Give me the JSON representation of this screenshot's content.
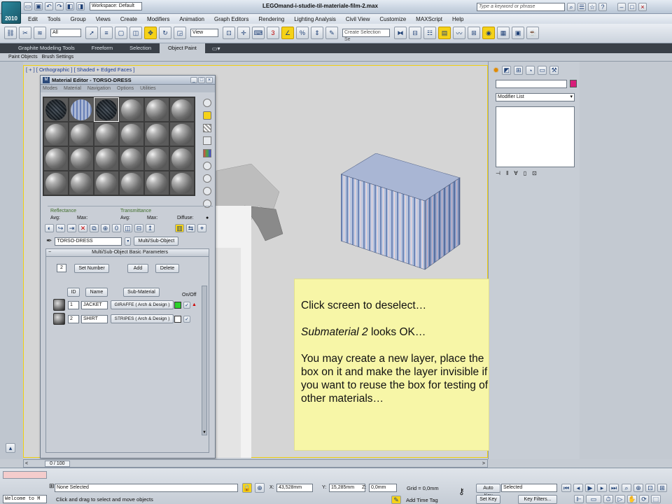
{
  "app": {
    "title": "LEGOmand-i-studie-til-materiale-film-2.max",
    "workspace": "Workspace: Default",
    "search_placeholder": "Type a keyword or phrase",
    "icon_label": "2010"
  },
  "menus": [
    "Edit",
    "Tools",
    "Group",
    "Views",
    "Create",
    "Modifiers",
    "Animation",
    "Graph Editors",
    "Rendering",
    "Lighting Analysis",
    "Civil View",
    "Customize",
    "MAXScript",
    "Help"
  ],
  "toolbar": {
    "selection_filter": "All",
    "ref_coord": "View",
    "named_selection_placeholder": "Create Selection Se"
  },
  "ribbon": {
    "tabs": [
      "Graphite Modeling Tools",
      "Freeform",
      "Selection",
      "Object Paint"
    ],
    "active_tab": "Object Paint",
    "subtabs": [
      "Paint Objects",
      "Brush Settings"
    ]
  },
  "viewport": {
    "label": "[ + ] [ Orthographic ] [ Shaded + Edged Faces ]"
  },
  "material_editor": {
    "title": "Material Editor - TORSO-DRESS",
    "menu": [
      "Modes",
      "Material",
      "Navigation",
      "Options",
      "Utilities"
    ],
    "reflectance_label": "Reflectance",
    "transmittance_label": "Transmittance",
    "avg1": "Avg:",
    "max1": "Max:",
    "avg2": "Avg:",
    "max2": "Max:",
    "diffuse": "Diffuse:",
    "material_name": "TORSO-DRESS",
    "material_type": "Multi/Sub-Object",
    "rollup_title": "Multi/Sub-Object Basic Parameters",
    "count": "2",
    "set_number": "Set Number",
    "add": "Add",
    "delete": "Delete",
    "col_id": "ID",
    "col_name": "Name",
    "col_sub": "Sub-Material",
    "col_onoff": "On/Off",
    "rows": [
      {
        "id": "1",
        "name": "JACKET",
        "sub": "GIRAFFE  ( Arch & Design )",
        "color": "#2bd12b"
      },
      {
        "id": "2",
        "name": "SHIRT",
        "sub": "STRIPES  ( Arch & Design )",
        "color": "#ffffff"
      }
    ]
  },
  "command_panel": {
    "modifier_list": "Modifier List"
  },
  "note": {
    "line1": "Click screen to deselect…",
    "line2_italic": "Submaterial 2",
    "line2_rest": " looks OK…",
    "line3": "You may create a new layer, place the box on it and make the layer invisible if you want to reuse the box for testing of other materials…"
  },
  "timeline": {
    "frame": "0 / 100"
  },
  "status": {
    "script": "Welcome to M",
    "selection": "None Selected",
    "prompt": "Click and drag to select and move objects",
    "x_label": "X:",
    "x": "43,528mm",
    "y_label": "Y:",
    "y": "15,285mm",
    "z_label": "Z:",
    "z": "0,0mm",
    "grid": "Grid = 0,0mm",
    "add_time_tag": "Add Time Tag",
    "auto_key": "Auto Key",
    "auto_key_value": "Selected",
    "set_key": "Set Key",
    "key_filters": "Key Filters..."
  },
  "colors": {
    "accent_highlight": "#f5d218",
    "note_bg": "#f7f6a7",
    "swatch_green": "#2bd12b"
  }
}
